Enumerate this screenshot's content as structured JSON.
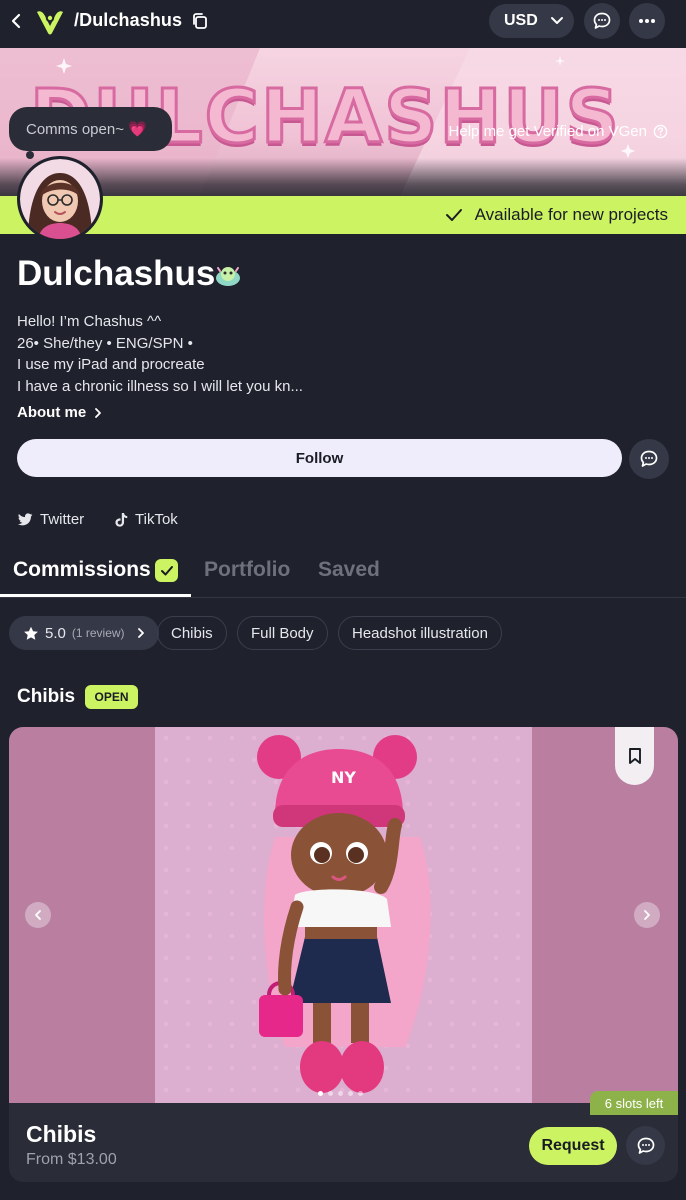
{
  "header": {
    "handle": "/Dulchashus",
    "currency": "USD"
  },
  "banner": {
    "title": "DULCHASHUS",
    "verify_text": "Help me get Verified on VGen"
  },
  "status_bubble": {
    "text": "Comms open~ 💗"
  },
  "availability": {
    "text": "Available for new projects",
    "color": "#ccf362"
  },
  "profile": {
    "name": "Dulchashus",
    "bio": [
      "Hello! I’m Chashus ^^",
      "26• She/they • ENG/SPN •",
      "I use my iPad and procreate",
      "I have a chronic illness so I will let you kn..."
    ],
    "about_label": "About me",
    "follow_label": "Follow"
  },
  "socials": [
    {
      "label": "Twitter",
      "icon": "twitter-icon"
    },
    {
      "label": "TikTok",
      "icon": "tiktok-icon"
    }
  ],
  "tabs": [
    {
      "label": "Commissions",
      "active": true
    },
    {
      "label": "Portfolio",
      "active": false
    },
    {
      "label": "Saved",
      "active": false
    }
  ],
  "filters": {
    "rating": "5.0",
    "review_count": "(1 review)",
    "chips": [
      "Chibis",
      "Full Body",
      "Headshot illustration"
    ]
  },
  "section": {
    "title": "Chibis",
    "status": "OPEN"
  },
  "card": {
    "title": "Chibis",
    "price": "From $13.00",
    "slots": "6 slots left",
    "request_label": "Request"
  },
  "colors": {
    "accent": "#ccf362",
    "background": "#1f212c",
    "surface": "#353846"
  }
}
